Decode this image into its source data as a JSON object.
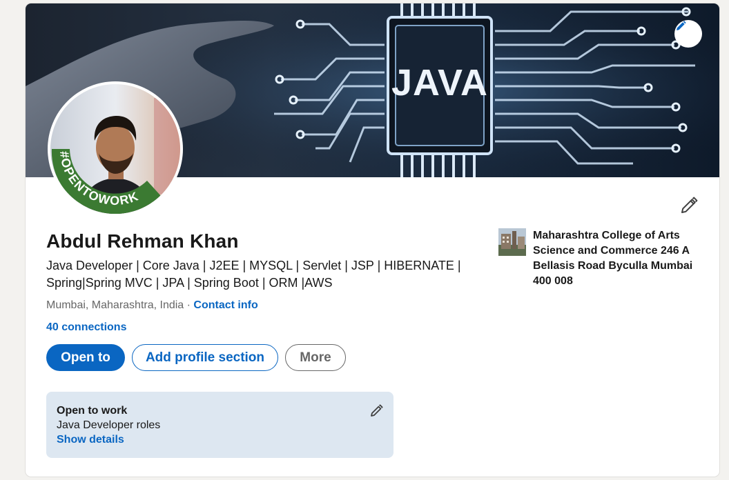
{
  "banner": {
    "chip_text": "JAVA",
    "edit_icon": "pencil-icon"
  },
  "avatar": {
    "badge_text": "#OPENTOWORK",
    "badge_color": "#3b7a32"
  },
  "profile": {
    "name": "Abdul Rehman Khan",
    "headline": "Java Developer | Core Java | J2EE | MYSQL | Servlet | JSP | HIBERNATE | Spring|Spring MVC | JPA | Spring Boot | ORM |AWS",
    "location": "Mumbai, Maharashtra, India",
    "separator": " · ",
    "contact_info": "Contact info",
    "connections": "40 connections",
    "edit_icon": "pencil-icon"
  },
  "actions": {
    "open_to": "Open to",
    "add_section": "Add profile section",
    "more": "More"
  },
  "education": {
    "school_name": "Maharashtra College of Arts Science and Commerce 246 A Bellasis Road Byculla Mumbai 400 008"
  },
  "open_to_work": {
    "title": "Open to work",
    "roles": "Java Developer roles",
    "show_details": "Show details",
    "edit_icon": "pencil-icon"
  },
  "colors": {
    "accent": "#0a66c2",
    "secondary_text": "#666666",
    "otw_card_bg": "#dde7f1",
    "page_bg": "#f3f2ef"
  }
}
